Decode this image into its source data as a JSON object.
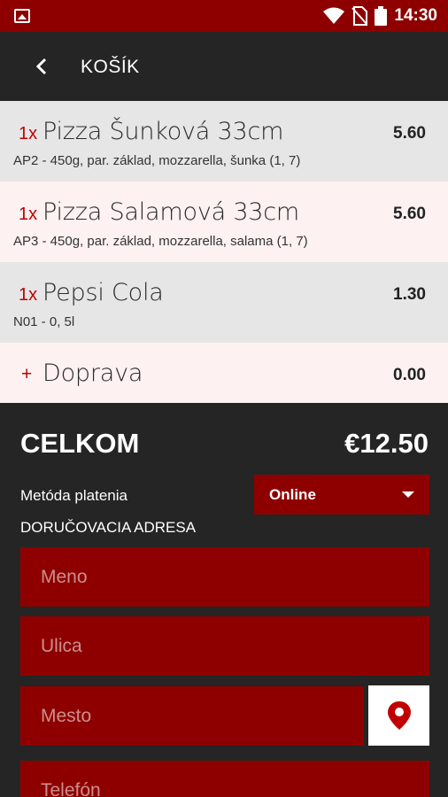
{
  "status_bar": {
    "time": "14:30"
  },
  "app_bar": {
    "title": "KOŠÍK"
  },
  "cart": {
    "items": [
      {
        "qty": "1x",
        "name": "Pizza Šunková 33cm",
        "desc": "AP2 - 450g, par. základ, mozzarella, šunka (1, 7)",
        "price": "5.60"
      },
      {
        "qty": "1x",
        "name": "Pizza Salamová 33cm",
        "desc": "AP3 - 450g, par. základ, mozzarella, salama (1, 7)",
        "price": "5.60"
      },
      {
        "qty": "1x",
        "name": "Pepsi Cola",
        "desc": "N01 - 0, 5l",
        "price": "1.30"
      }
    ],
    "shipping": {
      "symbol": "+",
      "name": "Doprava",
      "price": "0.00"
    }
  },
  "summary": {
    "total_label": "CELKOM",
    "total_value": "€12.50"
  },
  "payment": {
    "label": "Metóda platenia",
    "selected": "Online"
  },
  "address": {
    "label": "DORUČOVACIA ADRESA",
    "name_placeholder": "Meno",
    "street_placeholder": "Ulica",
    "city_placeholder": "Mesto",
    "phone_placeholder": "Telefón"
  },
  "colors": {
    "accent": "#8e0000",
    "dark": "#252525",
    "price_qty": "#c00000"
  }
}
